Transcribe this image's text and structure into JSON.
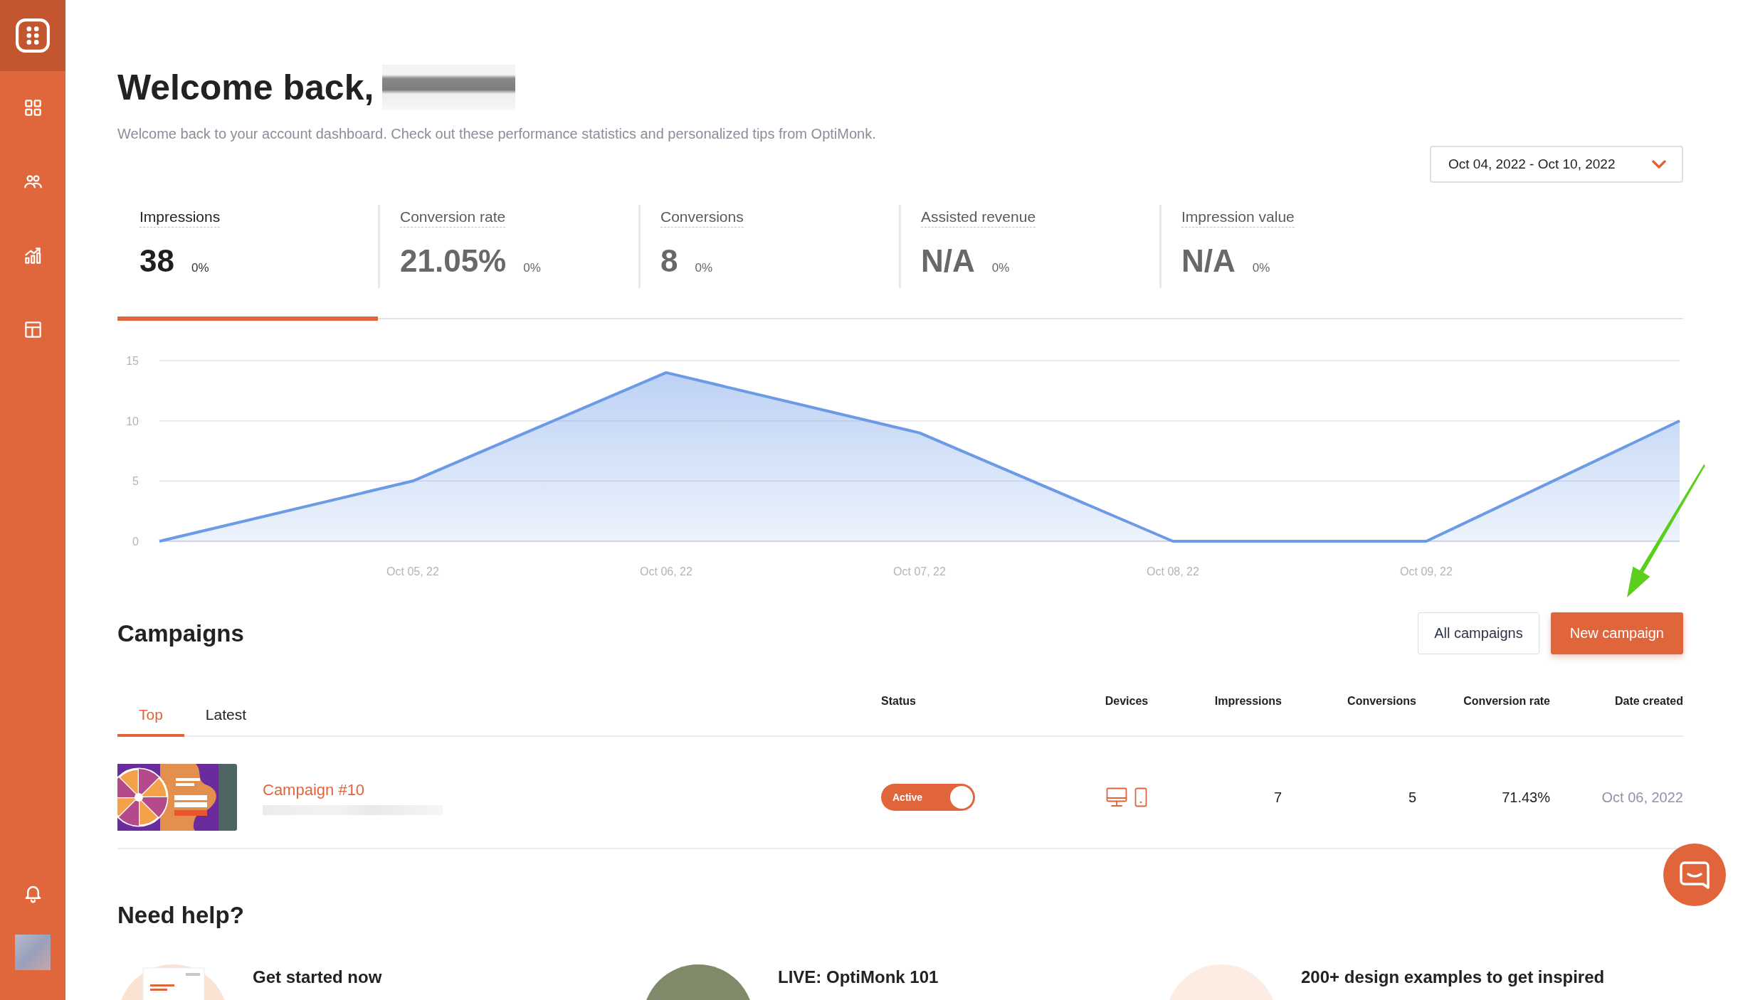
{
  "header": {
    "title": "Welcome back,",
    "subtitle": "Welcome back to your account dashboard. Check out these performance statistics and personalized tips from OptiMonk."
  },
  "date_range": {
    "value": "Oct 04, 2022 - Oct 10, 2022"
  },
  "stats": [
    {
      "label": "Impressions",
      "value": "38",
      "change": "0%",
      "selected": true
    },
    {
      "label": "Conversion rate",
      "value": "21.05%",
      "change": "0%",
      "selected": false
    },
    {
      "label": "Conversions",
      "value": "8",
      "change": "0%",
      "selected": false
    },
    {
      "label": "Assisted revenue",
      "value": "N/A",
      "change": "0%",
      "selected": false
    },
    {
      "label": "Impression value",
      "value": "N/A",
      "change": "0%",
      "selected": false
    }
  ],
  "chart": {
    "chart_data": {
      "type": "area",
      "categories": [
        null,
        "Oct 05, 22",
        "Oct 06, 22",
        "Oct 07, 22",
        "Oct 08, 22",
        "Oct 09, 22",
        null
      ],
      "ylim": [
        0,
        15
      ],
      "yticks": [
        0,
        5,
        10,
        15
      ],
      "series": [
        {
          "color": "#6b9ae6",
          "values": [
            0,
            5,
            14,
            9,
            0,
            0,
            10
          ]
        }
      ]
    }
  },
  "campaigns": {
    "title": "Campaigns",
    "buttons": [
      {
        "label": "All campaigns",
        "kind": "secondary"
      },
      {
        "label": "New campaign",
        "kind": "primary"
      }
    ],
    "tabs": [
      {
        "label": "Top",
        "selected": true
      },
      {
        "label": "Latest",
        "selected": false
      }
    ],
    "columns": [
      "Status",
      "Devices",
      "Impressions",
      "Conversions",
      "Conversion rate",
      "Date created"
    ],
    "rows": [
      {
        "name": "Campaign #10",
        "status": {
          "label": "Active",
          "on": true
        },
        "devices": [
          {
            "kind": "desktop"
          },
          {
            "kind": "mobile"
          }
        ],
        "impressions": "7",
        "conversions": "5",
        "conversion_rate": "71.43%",
        "date_created": "Oct 06, 2022"
      }
    ]
  },
  "help": {
    "title": "Need help?",
    "cards": [
      {
        "title": "Get started now",
        "kind": "guide"
      },
      {
        "title": "LIVE: OptiMonk 101",
        "kind": "webinar"
      },
      {
        "title": "200+ design examples to get inspired",
        "kind": "examples"
      }
    ]
  }
}
